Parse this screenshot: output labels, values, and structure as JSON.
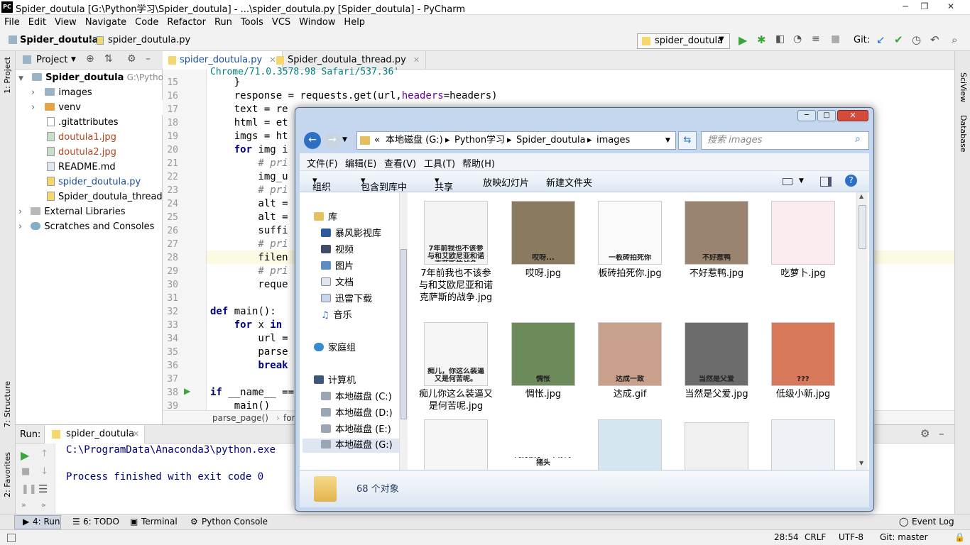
{
  "window": {
    "title": "Spider_doutula [G:\\Python学习\\Spider_doutula] - ...\\spider_doutula.py [Spider_doutula] - PyCharm",
    "logo": "PC"
  },
  "menu": [
    "File",
    "Edit",
    "View",
    "Navigate",
    "Code",
    "Refactor",
    "Run",
    "Tools",
    "VCS",
    "Window",
    "Help"
  ],
  "nav": {
    "project": "Spider_doutula",
    "file": "spider_doutula.py",
    "run_config": "spider_doutula",
    "git_label": "Git:"
  },
  "left_strip": {
    "project_tab": "1: Project",
    "structure_tab": "7: Structure",
    "favorites_tab": "2: Favorites"
  },
  "right_strip": {
    "sciview_tab": "SciView",
    "database_tab": "Database"
  },
  "project_panel": {
    "header": "Project",
    "root": "Spider_doutula",
    "root_path": "G:\\Python学",
    "items": [
      {
        "label": "images",
        "kind": "folder"
      },
      {
        "label": "venv",
        "kind": "folder-excluded"
      },
      {
        "label": ".gitattributes",
        "kind": "file"
      },
      {
        "label": "doutula1.jpg",
        "kind": "image"
      },
      {
        "label": "doutula2.jpg",
        "kind": "image"
      },
      {
        "label": "README.md",
        "kind": "markdown"
      },
      {
        "label": "spider_doutula.py",
        "kind": "python"
      },
      {
        "label": "Spider_doutula_thread.py",
        "kind": "python"
      }
    ],
    "external": "External Libraries",
    "scratches": "Scratches and Consoles"
  },
  "editor": {
    "tabs": [
      "spider_doutula.py",
      "Spider_doutula_thread.py"
    ],
    "line_numbers": [
      "15",
      "16",
      "17",
      "18",
      "19",
      "20",
      "21",
      "22",
      "23",
      "24",
      "25",
      "26",
      "27",
      "28",
      "29",
      "30",
      "31",
      "32",
      "33",
      "34",
      "35",
      "36",
      "37",
      "38",
      "39"
    ],
    "top_partial": "Chrome/71.0.3578.98 Safari/537.36'",
    "lines": {
      "l15": "    }",
      "l16a": "    response = requests.get(url,",
      "l16b": "headers",
      "l16c": "=headers)",
      "l17": "    text = re",
      "l18": "    html = et",
      "l19": "    imgs = ht",
      "l20a": "    ",
      "l20b": "for",
      "l20c": " img i",
      "l21": "        # pri",
      "l22": "        img_u",
      "l23": "        # pri",
      "l24": "        alt =",
      "l25": "        alt =",
      "l26": "        suffi",
      "l27": "        # pri",
      "l28": "        filen",
      "l29": "        # pri",
      "l30": "        reque",
      "l32a": "def",
      "l32b": " main():",
      "l33a": "    ",
      "l33b": "for",
      "l33c": " x ",
      "l33d": "in",
      "l34": "        url =",
      "l35": "        parse",
      "l36a": "        ",
      "l36b": "break",
      "l38a": "if",
      "l38b": " __name__ ==",
      "l39": "    main()"
    },
    "breadcrumb": [
      "parse_page()",
      "for"
    ]
  },
  "run": {
    "label": "Run:",
    "config": "spider_doutula",
    "cmd": "C:\\ProgramData\\Anaconda3\\python.exe",
    "exit": "Process finished with exit code 0"
  },
  "bottom_tabs": [
    "4: Run",
    "6: TODO",
    "Terminal",
    "Python Console"
  ],
  "event_log": "Event Log",
  "status": {
    "position": "28:54",
    "line_sep": "CRLF",
    "encoding": "UTF-8",
    "git": "Git: master"
  },
  "explorer": {
    "address": [
      "本地磁盘 (G:)",
      "Python学习",
      "Spider_doutula",
      "images"
    ],
    "search_placeholder": "搜索 images",
    "menu": [
      "文件(F)",
      "编辑(E)",
      "查看(V)",
      "工具(T)",
      "帮助(H)"
    ],
    "toolbar": [
      "组织",
      "包含到库中",
      "共享",
      "放映幻灯片",
      "新建文件夹"
    ],
    "nav_pane": {
      "library": "库",
      "lib_items": [
        "暴风影视库",
        "视频",
        "图片",
        "文档",
        "迅雷下载",
        "音乐"
      ],
      "homegroup": "家庭组",
      "computer": "计算机",
      "drives": [
        "本地磁盘 (C:)",
        "本地磁盘 (D:)",
        "本地磁盘 (E:)",
        "本地磁盘 (G:)"
      ]
    },
    "files": [
      {
        "name": "7年前我也不该参与和艾欧尼亚和诺克萨斯的战争.jpg",
        "caption": "7年前我也不该参与和艾欧尼亚和诺克萨斯的战争",
        "thumb": "#f4f4f4"
      },
      {
        "name": "哎呀.jpg",
        "caption": "哎呀...",
        "thumb": "#8a7a60"
      },
      {
        "name": "板砖拍死你.jpg",
        "caption": "一板砖拍死你",
        "thumb": "#fafafa"
      },
      {
        "name": "不好惹鸭.jpg",
        "caption": "不好惹鸭",
        "thumb": "#9a8470"
      },
      {
        "name": "吃萝卜.jpg",
        "caption": "",
        "thumb": "#fbecef"
      },
      {
        "name": "痴儿你这么装逼又是何苦呢.jpg",
        "caption": "痴儿，你这么装逼又是何苦呢。",
        "thumb": "#f6f6f6"
      },
      {
        "name": "惆怅.jpg",
        "caption": "惆怅",
        "thumb": "#6d8a5a"
      },
      {
        "name": "达成.gif",
        "caption": "达成一致",
        "thumb": "#c8a08c"
      },
      {
        "name": "当然是父爱.jpg",
        "caption": "当然是父爱",
        "thumb": "#6c6c6c"
      },
      {
        "name": "低级小新.jpg",
        "caption": "???",
        "thumb": "#d8785a"
      },
      {
        "name": "",
        "caption": "",
        "thumb": "#f6f6f6"
      },
      {
        "name": "",
        "caption": "对方摸了一下你的猪头",
        "thumb": "#ffffff"
      },
      {
        "name": "",
        "caption": "",
        "thumb": "#d6e6f0"
      },
      {
        "name": "",
        "caption": "",
        "thumb": "#f0f0f0"
      },
      {
        "name": "",
        "caption": "",
        "thumb": "#eef2f6"
      }
    ],
    "count": "68 个对象"
  },
  "colors": {
    "accent": "#2a5db0",
    "git_green": "#3aa63a",
    "modified_file": "#b2451a",
    "python_file": "#1b4fa0"
  }
}
